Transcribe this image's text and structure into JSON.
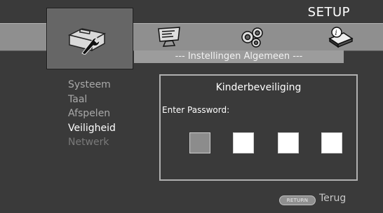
{
  "header": {
    "title": "SETUP"
  },
  "icons": {
    "general": "toolbox-wrench-icon",
    "display": "display-settings-icon",
    "audio": "audio-speakers-icon",
    "info": "info-book-icon"
  },
  "subheader": {
    "label": "--- Instellingen Algemeen ---"
  },
  "menu": {
    "items": [
      {
        "label": "Systeem"
      },
      {
        "label": "Taal"
      },
      {
        "label": "Afspelen"
      },
      {
        "label": "Veiligheid"
      },
      {
        "label": "Netwerk"
      }
    ],
    "selected": "Veiligheid"
  },
  "panel": {
    "title": "Kinderbeveiliging",
    "prompt": "Enter Password:",
    "password_digits": 4,
    "focused_digit": 1
  },
  "footer": {
    "return_label": "RETURN",
    "back_label": "Terug"
  },
  "colors": {
    "background": "#3a3a3a",
    "strip": "#8f8f8f",
    "tile": "#666666",
    "subheader": "#9c9c9c",
    "active_text": "#ffffff",
    "inactive_text": "#a9a9a9"
  }
}
